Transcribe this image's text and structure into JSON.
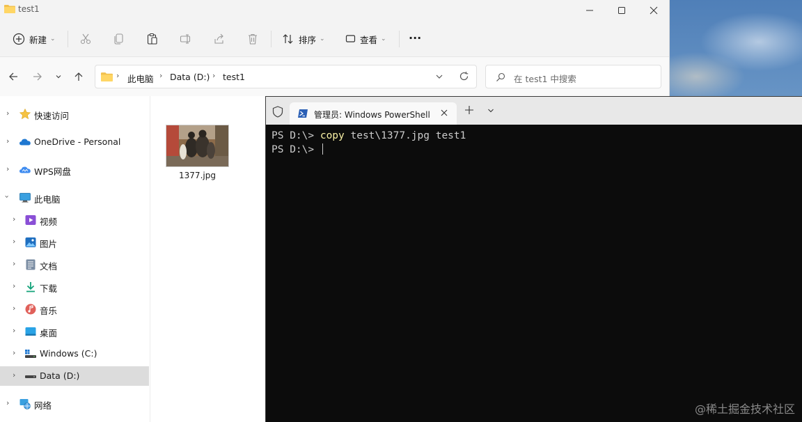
{
  "explorer": {
    "title": "test1",
    "toolbar": {
      "new_label": "新建",
      "sort_label": "排序",
      "view_label": "查看",
      "more_label": "···"
    },
    "breadcrumbs": [
      "此电脑",
      "Data (D:)",
      "test1"
    ],
    "search_placeholder": "在 test1 中搜索",
    "sidebar": [
      {
        "label": "快速访问",
        "icon": "star-icon"
      },
      {
        "label": "OneDrive - Personal",
        "icon": "cloud-icon"
      },
      {
        "label": "WPS网盘",
        "icon": "cloud-icon"
      },
      {
        "label": "此电脑",
        "icon": "computer-icon"
      },
      {
        "label": "视频",
        "icon": "video-icon"
      },
      {
        "label": "图片",
        "icon": "image-icon"
      },
      {
        "label": "文档",
        "icon": "document-icon"
      },
      {
        "label": "下载",
        "icon": "download-icon"
      },
      {
        "label": "音乐",
        "icon": "music-icon"
      },
      {
        "label": "桌面",
        "icon": "desktop-icon"
      },
      {
        "label": "Windows (C:)",
        "icon": "drive-icon"
      },
      {
        "label": "Data (D:)",
        "icon": "drive-icon",
        "selected": true
      },
      {
        "label": "网络",
        "icon": "network-icon"
      }
    ],
    "files": [
      {
        "name": "1377.jpg"
      }
    ]
  },
  "terminal": {
    "tab_title": "管理员: Windows PowerShell",
    "lines": [
      {
        "prompt": "PS D:\\> ",
        "command": "copy",
        "args": " test\\1377.jpg test1"
      },
      {
        "prompt": "PS D:\\> ",
        "command": "",
        "args": ""
      }
    ]
  },
  "watermark": "@稀土掘金技术社区",
  "colors": {
    "terminal_bg": "#0c0c0c",
    "terminal_text": "#cccccc",
    "command_highlight": "#f9f1a5",
    "selected_nav": "#dcdcdc"
  }
}
